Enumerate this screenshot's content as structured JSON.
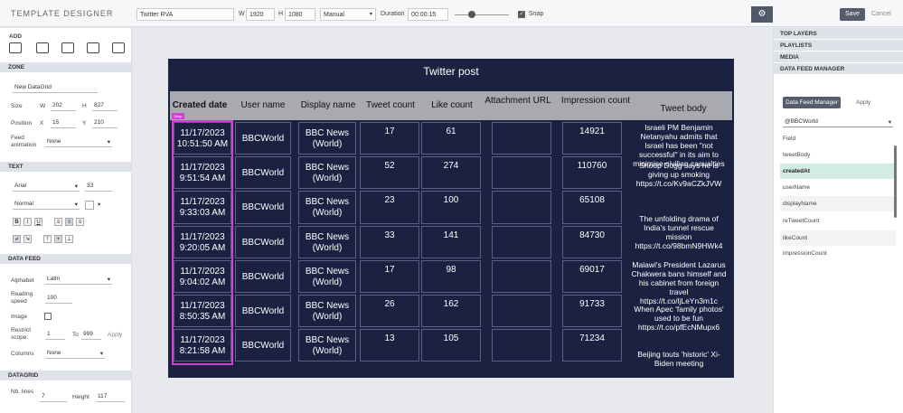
{
  "topbar": {
    "app_title": "TEMPLATE DESIGNER",
    "template_name": "Twitter RVA",
    "w_label": "W",
    "width_value": "1920",
    "h_label": "H",
    "height_value": "1080",
    "mode_value": "Manual",
    "duration_label": "Duration",
    "duration_value": "00:00:15",
    "snap_label": "Snap",
    "snap_checked": "✓",
    "save_label": "Save",
    "cancel_label": "Cancel",
    "settings_icon": "⚙"
  },
  "left": {
    "add_label": "ADD",
    "zone_head": "ZONE",
    "zone_name": "New DataGrid",
    "size_label": "Size",
    "w_label": "W",
    "w_value": "202",
    "h_label": "H",
    "h_value": "827",
    "position_label": "Position",
    "x_label": "X",
    "x_value": "15",
    "y_label": "Y",
    "y_value": "210",
    "feed_anim_label": "Feed animation",
    "feed_anim_value": "None",
    "text_head": "TEXT",
    "font_value": "Arial",
    "font_size_value": "33",
    "style_value": "Normal",
    "bold": "B",
    "italic": "I",
    "underline": "U",
    "datafeed_head": "DATA FEED",
    "alphabet_label": "Alphabet",
    "alphabet_value": "Latin",
    "reading_label": "Reading speed",
    "reading_value": "100",
    "image_label": "Image",
    "restrict_label": "Restrict scope:",
    "restrict_from": "1",
    "to_label": "To",
    "restrict_to": "999",
    "apply_label": "Apply",
    "columns_label": "Columns",
    "columns_value": "None",
    "datagrid_head": "DATAGRID",
    "nb_lines_label": "Nb. lines",
    "nb_lines_value": "7",
    "height_label": "Height",
    "height_value": "117"
  },
  "canvas": {
    "title": "Twitter post",
    "headers": [
      "Created date",
      "User name",
      "Display name",
      "Tweet count",
      "Like count",
      "Attachment URL",
      "Impression count",
      "Tweet body"
    ],
    "selection_tag": "Drop",
    "rows": [
      {
        "date1": "11/17/2023",
        "date2": "10:51:50 AM",
        "user": "BBCWorld",
        "disp1": "BBC News",
        "disp2": "(World)",
        "tweets": "17",
        "likes": "61",
        "impr": "14921"
      },
      {
        "date1": "11/17/2023",
        "date2": "9:51:54 AM",
        "user": "BBCWorld",
        "disp1": "BBC News",
        "disp2": "(World)",
        "tweets": "52",
        "likes": "274",
        "impr": "110760"
      },
      {
        "date1": "11/17/2023",
        "date2": "9:33:03 AM",
        "user": "BBCWorld",
        "disp1": "BBC News",
        "disp2": "(World)",
        "tweets": "23",
        "likes": "100",
        "impr": "65108"
      },
      {
        "date1": "11/17/2023",
        "date2": "9:20:05 AM",
        "user": "BBCWorld",
        "disp1": "BBC News",
        "disp2": "(World)",
        "tweets": "33",
        "likes": "141",
        "impr": "84730"
      },
      {
        "date1": "11/17/2023",
        "date2": "9:04:02 AM",
        "user": "BBCWorld",
        "disp1": "BBC News",
        "disp2": "(World)",
        "tweets": "17",
        "likes": "98",
        "impr": "69017"
      },
      {
        "date1": "11/17/2023",
        "date2": "8:50:35 AM",
        "user": "BBCWorld",
        "disp1": "BBC News",
        "disp2": "(World)",
        "tweets": "26",
        "likes": "162",
        "impr": "91733"
      },
      {
        "date1": "11/17/2023",
        "date2": "8:21:58 AM",
        "user": "BBCWorld",
        "disp1": "BBC News",
        "disp2": "(World)",
        "tweets": "13",
        "likes": "105",
        "impr": "71234"
      }
    ],
    "bodies": [
      "Israeli PM Benjamin Netanyahu admits that Israel has been \"not successful\" in its aim to minimise civilian casualties",
      "Snoop Dogg says he is giving up smoking https://t.co/Kv9aCZkJVW",
      "The unfolding drama of India's tunnel rescue mission https://t.co/98bmN9HWk4",
      "Malawi's President Lazarus Chakwera bans himself and his cabinet from foreign travel https://t.co/ljLeYn3m1c",
      "When Apec 'family photos' used to be fun https://t.co/pfEcNMupx6",
      "Beijing touts 'historic' Xi-Biden meeting"
    ]
  },
  "right": {
    "top_layers": "TOP LAYERS",
    "playlists": "PLAYLISTS",
    "media": "MEDIA",
    "dfm_head": "DATA FEED MANAGER",
    "tab_dfm": "Data Feed Manager",
    "tab_apply": "Apply",
    "feed_value": "@BBCWorld",
    "field_label": "Field",
    "fields": [
      "tweetBody",
      "createdAt",
      "userName",
      "displayName",
      "reTweetCount",
      "likeCount",
      "impressionCount"
    ]
  }
}
